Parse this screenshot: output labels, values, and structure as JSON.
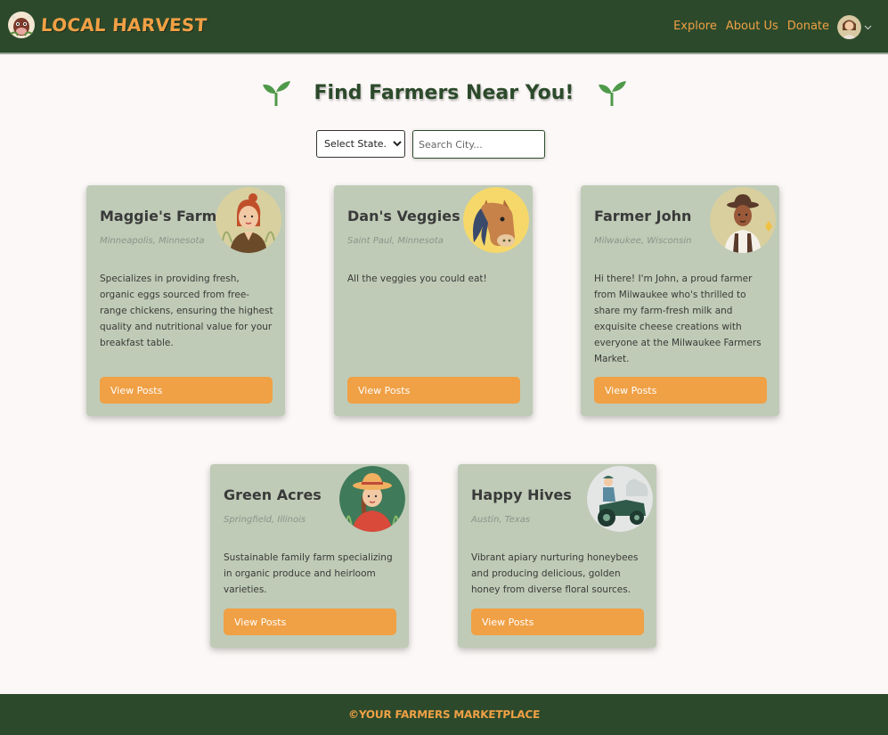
{
  "header": {
    "brand": "LOCAL HARVEST",
    "nav": [
      "Explore",
      "About Us",
      "Donate"
    ]
  },
  "page": {
    "title": "Find Farmers Near You!"
  },
  "filters": {
    "state_value": "Select State...",
    "city_placeholder": "Search City..."
  },
  "farmers": [
    {
      "name": "Maggie's Farm",
      "location": "Minneapolis, Minnesota",
      "description": "Specializes in providing fresh, organic eggs sourced from free-range chickens, ensuring the highest quality and nutritional value for your breakfast table.",
      "button": "View Posts",
      "avatar": "woman-farmer-icon"
    },
    {
      "name": "Dan's Veggies",
      "location": "Saint Paul, Minnesota",
      "description": "All the veggies you could eat!",
      "button": "View Posts",
      "avatar": "horse-icon"
    },
    {
      "name": "Farmer John",
      "location": "Milwaukee, Wisconsin",
      "description": "Hi there! I'm John, a proud farmer from Milwaukee who's thrilled to share my farm-fresh milk and exquisite cheese creations with everyone at the Milwaukee Farmers Market.",
      "button": "View Posts",
      "avatar": "man-farmer-icon"
    },
    {
      "name": "Green Acres",
      "location": "Springfield, Illinois",
      "description": "Sustainable family farm specializing in organic produce and heirloom varieties.",
      "button": "View Posts",
      "avatar": "straw-hat-farmer-icon"
    },
    {
      "name": "Happy Hives",
      "location": "Austin, Texas",
      "description": "Vibrant apiary nurturing honeybees and producing delicious, golden honey from diverse floral sources.",
      "button": "View Posts",
      "avatar": "tractor-icon"
    }
  ],
  "footer": {
    "text": "©YOUR FARMERS MARKETPLACE"
  },
  "colors": {
    "header_bg": "#2c4a2b",
    "accent": "#f0a045",
    "card_bg": "#bfcbb6",
    "page_bg": "#fcf8f7"
  }
}
